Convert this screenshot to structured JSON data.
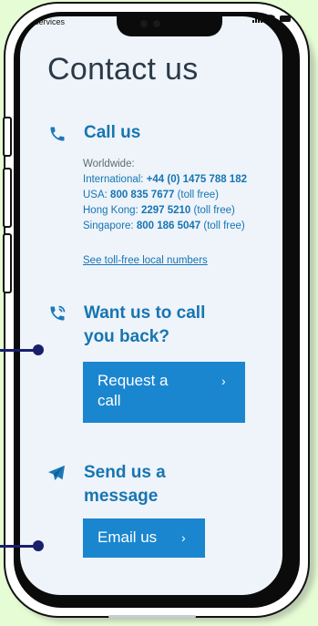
{
  "status_bar": {
    "carrier": "services"
  },
  "page": {
    "title": "Contact us"
  },
  "call_us": {
    "heading": "Call us",
    "worldwide": "Worldwide:",
    "intl_label": "International: ",
    "intl_number": "+44 (0) 1475 788 182",
    "usa_label": "USA: ",
    "usa_number": "800 835 7677",
    "usa_suffix": " (toll free)",
    "hk_label": "Hong Kong: ",
    "hk_number": "2297 5210",
    "hk_suffix": " (toll free)",
    "sg_label": "Singapore: ",
    "sg_number": "800 186 5047",
    "sg_suffix": " (toll free)",
    "toll_free_link": "See toll-free local numbers"
  },
  "call_back": {
    "heading_line1": "Want us to call",
    "heading_line2": "you back?",
    "button_line1": "Request a",
    "button_line2": "call"
  },
  "message": {
    "heading_line1": "Send us a",
    "heading_line2": "message",
    "button_label": "Email us"
  },
  "colors": {
    "accent": "#1a86cf",
    "heading": "#1775b2",
    "pointer": "#1a1f6b",
    "background": "#e6fcd4"
  },
  "icons": [
    "phone-icon",
    "callback-phone-icon",
    "paper-plane-icon",
    "chevron-right-icon"
  ]
}
